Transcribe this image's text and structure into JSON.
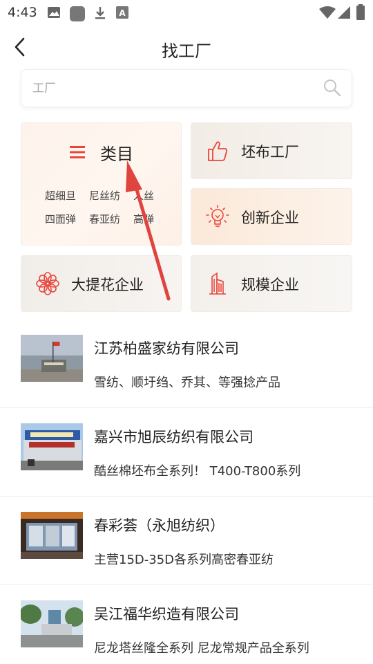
{
  "status_bar": {
    "time": "4:43",
    "icons": [
      "image-icon",
      "app-square-icon",
      "download-icon",
      "font-a-icon",
      "wifi-icon",
      "signal-icon",
      "battery-icon"
    ]
  },
  "header": {
    "title": "找工厂",
    "back_icon": "chevron-left-icon"
  },
  "search": {
    "placeholder": "工厂",
    "icon": "search-icon"
  },
  "categories": {
    "main": {
      "title": "类目",
      "icon": "menu-icon",
      "accent": "#e8453c",
      "tags": [
        "超细旦",
        "尼丝纺",
        "人丝",
        "四面弹",
        "春亚纺",
        "高弹"
      ]
    },
    "items": [
      {
        "label": "坯布工厂",
        "icon": "thumbs-up-icon"
      },
      {
        "label": "创新企业",
        "icon": "lightbulb-icon"
      },
      {
        "label": "大提花企业",
        "icon": "flower-icon"
      },
      {
        "label": "规模企业",
        "icon": "building-icon"
      }
    ]
  },
  "companies": [
    {
      "name": "江苏柏盛家纺有限公司",
      "desc": "雪纺、顺圩绉、乔其、等强捻产品"
    },
    {
      "name": "嘉兴市旭辰纺织有限公司",
      "desc": "酷丝棉坯布全系列！ T400-T800系列"
    },
    {
      "name": "春彩荟（永旭纺织）",
      "desc": "主营15D-35D各系列高密春亚纺"
    },
    {
      "name": "吴江福华织造有限公司",
      "desc": "尼龙塔丝隆全系列 尼龙常规产品全系列"
    }
  ],
  "colors": {
    "accent_red": "#e8453c",
    "arrow_red": "#e0443f"
  }
}
